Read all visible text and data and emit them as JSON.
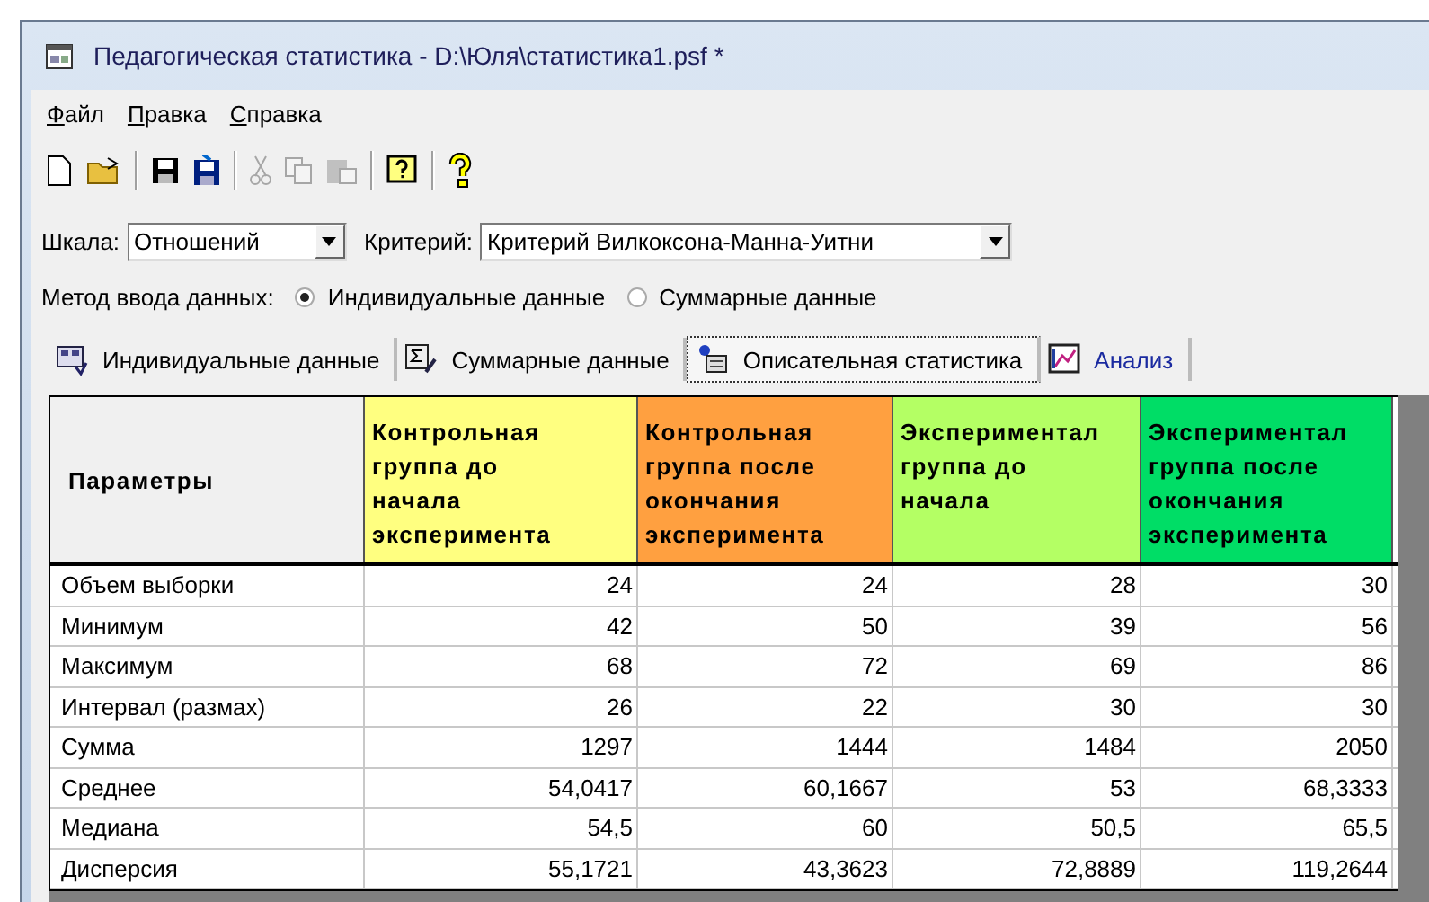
{
  "window": {
    "title": "Педагогическая статистика - D:\\Юля\\статистика1.psf *"
  },
  "menu": [
    {
      "label": "Файл"
    },
    {
      "label": "Правка"
    },
    {
      "label": "Справка"
    }
  ],
  "toolbar": [
    {
      "kind": "new",
      "disabled": false
    },
    {
      "kind": "open",
      "disabled": false
    },
    {
      "kind": "sep"
    },
    {
      "kind": "save",
      "disabled": false
    },
    {
      "kind": "saveas",
      "disabled": false
    },
    {
      "kind": "sep"
    },
    {
      "kind": "cut",
      "disabled": true
    },
    {
      "kind": "copy",
      "disabled": true
    },
    {
      "kind": "paste",
      "disabled": true
    },
    {
      "kind": "sep"
    },
    {
      "kind": "help",
      "disabled": false
    },
    {
      "kind": "sep"
    },
    {
      "kind": "hint",
      "disabled": false
    }
  ],
  "scale": {
    "label": "Шкала:",
    "value": "Отношений"
  },
  "criterion": {
    "label": "Критерий:",
    "value": "Критерий Вилкоксона-Манна-Уитни"
  },
  "input_method": {
    "label": "Метод ввода данных:",
    "options": [
      {
        "label": "Индивидуальные данные",
        "selected": true
      },
      {
        "label": "Суммарные данные",
        "selected": false
      }
    ]
  },
  "tabs": [
    {
      "label": "Индивидуальные данные",
      "kind": "individual",
      "selected": false
    },
    {
      "label": "Суммарные данные",
      "kind": "sum",
      "selected": false
    },
    {
      "label": "Описательная статистика",
      "kind": "descriptive",
      "selected": true
    },
    {
      "label": "Анализ",
      "kind": "analysis",
      "selected": false
    }
  ],
  "table": {
    "columns": [
      {
        "lines": [
          "Параметры"
        ]
      },
      {
        "lines": [
          "Контрольная",
          "группа до",
          "начала",
          "эксперимента"
        ],
        "color": "#ffff80"
      },
      {
        "lines": [
          "Контрольная",
          "группа после",
          "окончания",
          "эксперимента"
        ],
        "color": "#ffa040"
      },
      {
        "lines": [
          "Экспериментал",
          "группа до",
          "начала"
        ],
        "color": "#b4ff64"
      },
      {
        "lines": [
          "Экспериментал",
          "группа после",
          "окончания",
          "эксперимента"
        ],
        "color": "#00dd66"
      }
    ],
    "rows": [
      [
        "Объем выборки",
        "24",
        "24",
        "28",
        "30"
      ],
      [
        "Минимум",
        "42",
        "50",
        "39",
        "56"
      ],
      [
        "Максимум",
        "68",
        "72",
        "69",
        "86"
      ],
      [
        "Интервал (размах)",
        "26",
        "22",
        "30",
        "30"
      ],
      [
        "Сумма",
        "1297",
        "1444",
        "1484",
        "2050"
      ],
      [
        "Среднее",
        "54,0417",
        "60,1667",
        "53",
        "68,3333"
      ],
      [
        "Медиана",
        "54,5",
        "60",
        "50,5",
        "65,5"
      ],
      [
        "Дисперсия",
        "55,1721",
        "43,3623",
        "72,8889",
        "119,2644"
      ]
    ]
  }
}
